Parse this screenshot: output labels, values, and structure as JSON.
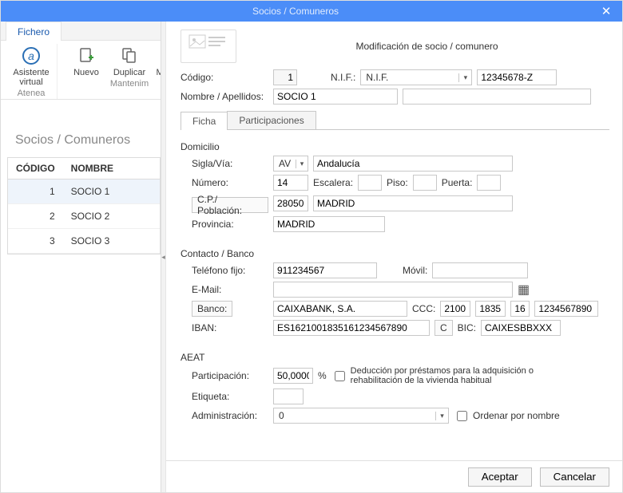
{
  "window": {
    "title": "Socios / Comuneros",
    "close": "✕"
  },
  "menu": {
    "fichero": "Fichero"
  },
  "ribbon": {
    "group1": {
      "title": "Atenea",
      "btn1": "Asistente\nvirtual"
    },
    "group2": {
      "title": "Mantenim",
      "btn1": "Nuevo",
      "btn2": "Duplicar",
      "btn3": "Modifica"
    }
  },
  "page_heading": "Socios / Comuneros",
  "list": {
    "head_codigo": "CÓDIGO",
    "head_nombre": "NOMBRE",
    "rows": [
      {
        "codigo": "1",
        "nombre": "SOCIO 1"
      },
      {
        "codigo": "2",
        "nombre": "SOCIO 2"
      },
      {
        "codigo": "3",
        "nombre": "SOCIO 3"
      }
    ]
  },
  "panel": {
    "heading": "Modificación de socio / comunero",
    "codigo_lbl": "Código:",
    "codigo_val": "1",
    "nif_lbl": "N.I.F.:",
    "nif_type": "N.I.F.",
    "nif_val": "12345678-Z",
    "nombre_lbl": "Nombre / Apellidos:",
    "nombre_val": "SOCIO 1",
    "apellidos_val": "",
    "tab_ficha": "Ficha",
    "tab_part": "Participaciones",
    "domicilio": {
      "title": "Domicilio",
      "sigla_lbl": "Sigla/Vía:",
      "sigla_val": "AV",
      "via_val": "Andalucía",
      "numero_lbl": "Número:",
      "numero_val": "14",
      "escalera_lbl": "Escalera:",
      "escalera_val": "",
      "piso_lbl": "Piso:",
      "piso_val": "",
      "puerta_lbl": "Puerta:",
      "puerta_val": "",
      "cp_lbl": "C.P./ Población:",
      "cp_val": "28050",
      "poblacion_val": "MADRID",
      "provincia_lbl": "Provincia:",
      "provincia_val": "MADRID"
    },
    "contacto": {
      "title": "Contacto / Banco",
      "tel_lbl": "Teléfono fijo:",
      "tel_val": "911234567",
      "movil_lbl": "Móvil:",
      "movil_val": "",
      "email_lbl": "E-Mail:",
      "email_val": "",
      "banco_lbl": "Banco:",
      "banco_val": "CAIXABANK, S.A.",
      "ccc_lbl": "CCC:",
      "ccc1": "2100",
      "ccc2": "1835",
      "ccc3": "16",
      "ccc4": "1234567890",
      "iban_lbl": "IBAN:",
      "iban_val": "ES1621001835161234567890",
      "calc_btn": "C",
      "bic_lbl": "BIC:",
      "bic_val": "CAIXESBBXXX"
    },
    "aeat": {
      "title": "AEAT",
      "part_lbl": "Participación:",
      "part_val": "50,0000",
      "part_pct": "%",
      "ded_lbl": "Deducción por préstamos para la adquisición o rehabilitación de la vivienda habitual",
      "etiqueta_lbl": "Etiqueta:",
      "etiqueta_val": "",
      "admin_lbl": "Administración:",
      "admin_val": "0",
      "ordenar_lbl": "Ordenar por nombre"
    },
    "aceptar": "Aceptar",
    "cancelar": "Cancelar"
  }
}
